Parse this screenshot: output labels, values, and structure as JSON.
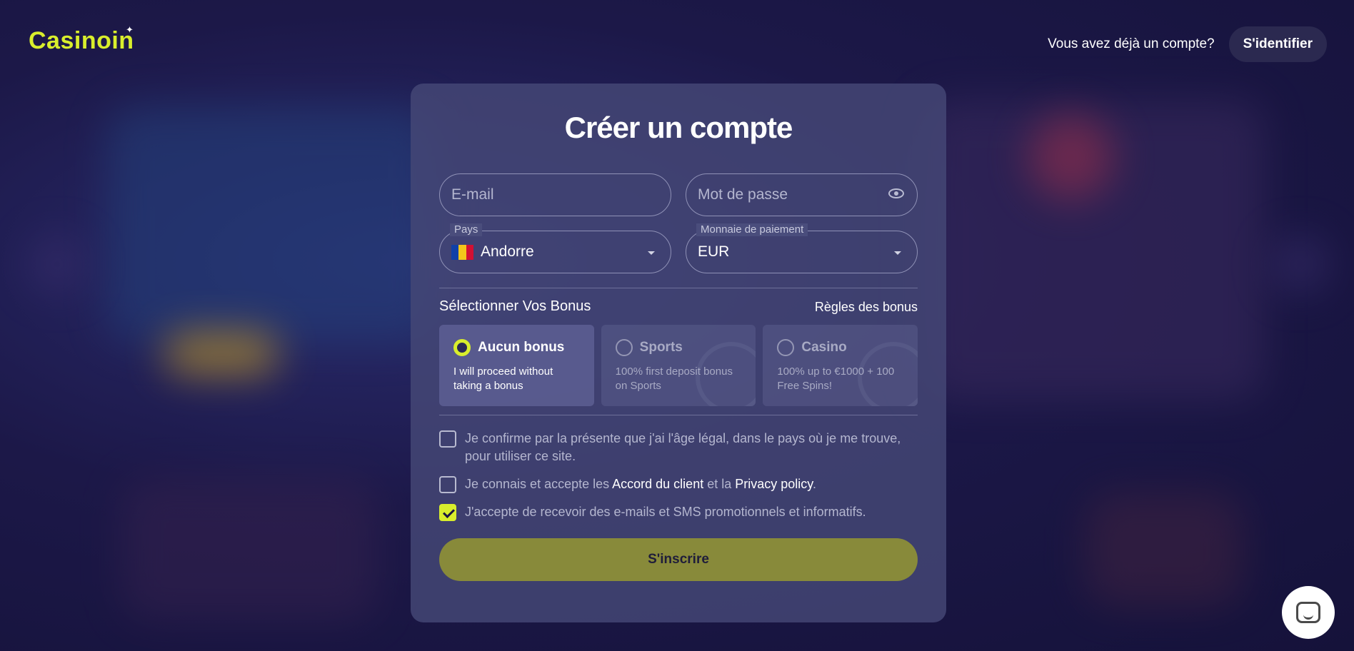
{
  "brand": {
    "logo_text": "Casinoin",
    "accent_color": "#d9ee2c"
  },
  "header": {
    "account_question": "Vous avez déjà un compte?",
    "login_label": "S'identifier"
  },
  "form": {
    "title": "Créer un compte",
    "email": {
      "placeholder": "E-mail",
      "value": ""
    },
    "password": {
      "placeholder": "Mot de passe",
      "value": ""
    },
    "country": {
      "legend": "Pays",
      "value": "Andorre"
    },
    "currency": {
      "legend": "Monnaie de paiement",
      "value": "EUR"
    }
  },
  "bonus": {
    "section_title": "Sélectionner Vos Bonus",
    "rules_link": "Règles des bonus",
    "options": [
      {
        "name": "Aucun bonus",
        "description": "I will proceed without taking a bonus",
        "selected": true
      },
      {
        "name": "Sports",
        "description": "100% first deposit bonus on Sports",
        "selected": false
      },
      {
        "name": "Casino",
        "description": "100% up to €1000 + 100 Free Spins!",
        "selected": false
      }
    ]
  },
  "consents": {
    "age": {
      "text": "Je confirme par la présente que j'ai l'âge légal, dans le pays où je me trouve, pour utiliser ce site.",
      "checked": false
    },
    "terms": {
      "prefix": "Je connais et accepte les ",
      "link1": "Accord du client",
      "middle": " et la ",
      "link2": "Privacy policy",
      "suffix": ".",
      "checked": false
    },
    "marketing": {
      "text": "J'accepte de recevoir des e-mails et SMS promotionnels et informatifs.",
      "checked": true
    }
  },
  "submit_label": "S'inscrire",
  "icons": {
    "password_toggle": "eye-icon",
    "country_flag": "andorra-flag-icon",
    "dropdown": "chevron-down-icon",
    "chat": "chat-icon"
  }
}
